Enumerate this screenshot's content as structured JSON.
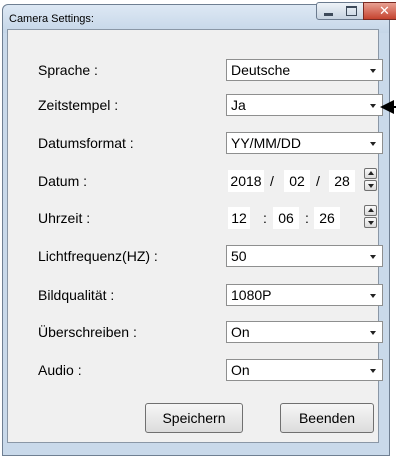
{
  "window": {
    "title": "Camera Settings:",
    "controls": {
      "minimize": "minimize",
      "maximize": "maximize",
      "close": "✕"
    }
  },
  "settings": [
    {
      "label": "Sprache :",
      "value": "Deutsche"
    },
    {
      "label": "Zeitstempel :",
      "value": "Ja"
    },
    {
      "label": "Datumsformat :",
      "value": "YY/MM/DD"
    }
  ],
  "date": {
    "label": "Datum :",
    "year": "2018",
    "month": "02",
    "day": "28",
    "sep": "/"
  },
  "time": {
    "label": "Uhrzeit :",
    "hour": "12",
    "minute": "06",
    "second": "26",
    "sep": ":"
  },
  "settings2": [
    {
      "label": "Lichtfrequenz(HZ) :",
      "value": "50"
    },
    {
      "label": "Bildqualität :",
      "value": "1080P"
    },
    {
      "label": "Überschreiben :",
      "value": "On"
    },
    {
      "label": "Audio :",
      "value": "On"
    }
  ],
  "buttons": {
    "save": "Speichern",
    "exit": "Beenden"
  }
}
